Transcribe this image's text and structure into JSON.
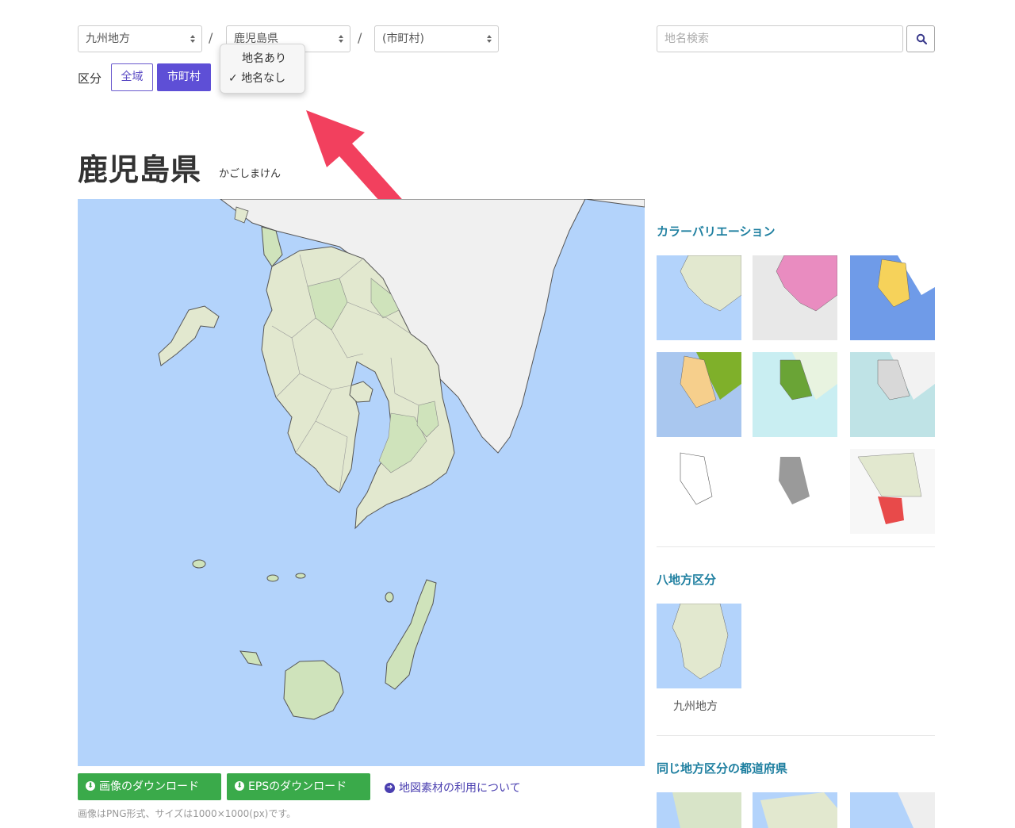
{
  "breadcrumb": {
    "region": "九州地方",
    "prefecture": "鹿児島県",
    "city": "(市町村)",
    "separator": "/"
  },
  "search": {
    "placeholder": "地名検索"
  },
  "division": {
    "label": "区分",
    "whole": "全域",
    "municipality": "市町村"
  },
  "dropdown": {
    "items": [
      {
        "label": "地名あり",
        "checked": false
      },
      {
        "label": "地名なし",
        "checked": true
      }
    ],
    "check": "✓"
  },
  "page": {
    "title": "鹿児島県",
    "reading": "かごしまけん"
  },
  "sidebar": {
    "color_variation_heading": "カラーバリエーション",
    "regions_heading": "八地方区分",
    "region_caption": "九州地方",
    "same_region_heading": "同じ地方区分の都道府県"
  },
  "downloads": {
    "image": "画像のダウンロード",
    "eps": "EPSのダウンロード",
    "usage": "地図素材の利用について",
    "note": "画像はPNG形式、サイズは1000×1000(px)です。"
  },
  "colors": {
    "accent": "#5e4fd6",
    "heading": "#1e7fa0",
    "download": "#3aaa4a",
    "sea": "#b3d3fb",
    "land": "#e2e8cf",
    "arrow": "#f2405e"
  }
}
